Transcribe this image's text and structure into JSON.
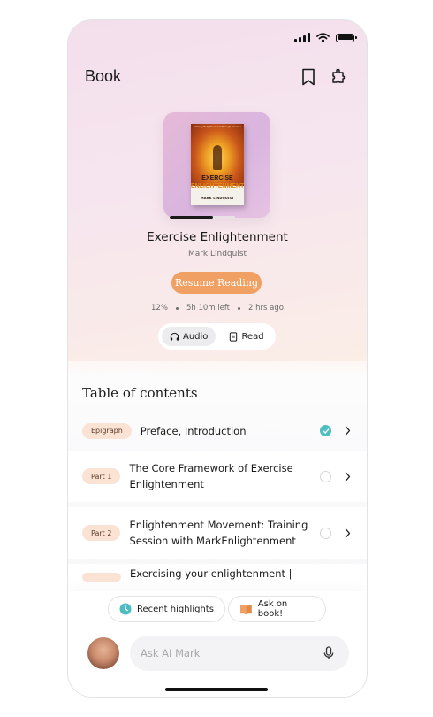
{
  "header": {
    "title": "Book"
  },
  "book": {
    "title": "Exercise Enlightenment",
    "author": "Mark Lindquist",
    "cover": {
      "top_text": "Embody Enlightenment Through Exercise",
      "title_line1": "EXERCISE",
      "title_line2": "ENLIGHTENMENT",
      "author": "MARK LINDQUIST"
    },
    "progress_fraction": 0.12
  },
  "resume_label": "Resume Reading",
  "stats": {
    "percent": "12%",
    "time_left": "5h 10m left",
    "last_read": "2 hrs ago"
  },
  "modes": {
    "audio": "Audio",
    "read": "Read",
    "active": "audio"
  },
  "toc": {
    "title": "Table of contents",
    "items": [
      {
        "tag": "Epigraph",
        "title": "Preface, Introduction",
        "done": true
      },
      {
        "tag": "Part 1",
        "title": "The Core Framework of Exercise Enlightenment",
        "done": false
      },
      {
        "tag": "Part 2",
        "title": "Enlightenment Movement: Training Session with MarkEnlightenment",
        "done": false
      },
      {
        "tag": "",
        "title": "Exercising your enlightenment |",
        "done": false
      }
    ]
  },
  "chips": {
    "highlights": "Recent highlights",
    "ask_book": "Ask on book!"
  },
  "ask": {
    "placeholder": "Ask AI Mark"
  },
  "colors": {
    "accent": "#f0a062",
    "check": "#4dbdc2",
    "pill": "#fbe3d4"
  },
  "icons": [
    "bookmark-icon",
    "puzzle-icon",
    "headphones-icon",
    "book-icon",
    "check-icon",
    "chevron-right-icon",
    "clock-icon",
    "open-book-icon",
    "mic-icon"
  ]
}
